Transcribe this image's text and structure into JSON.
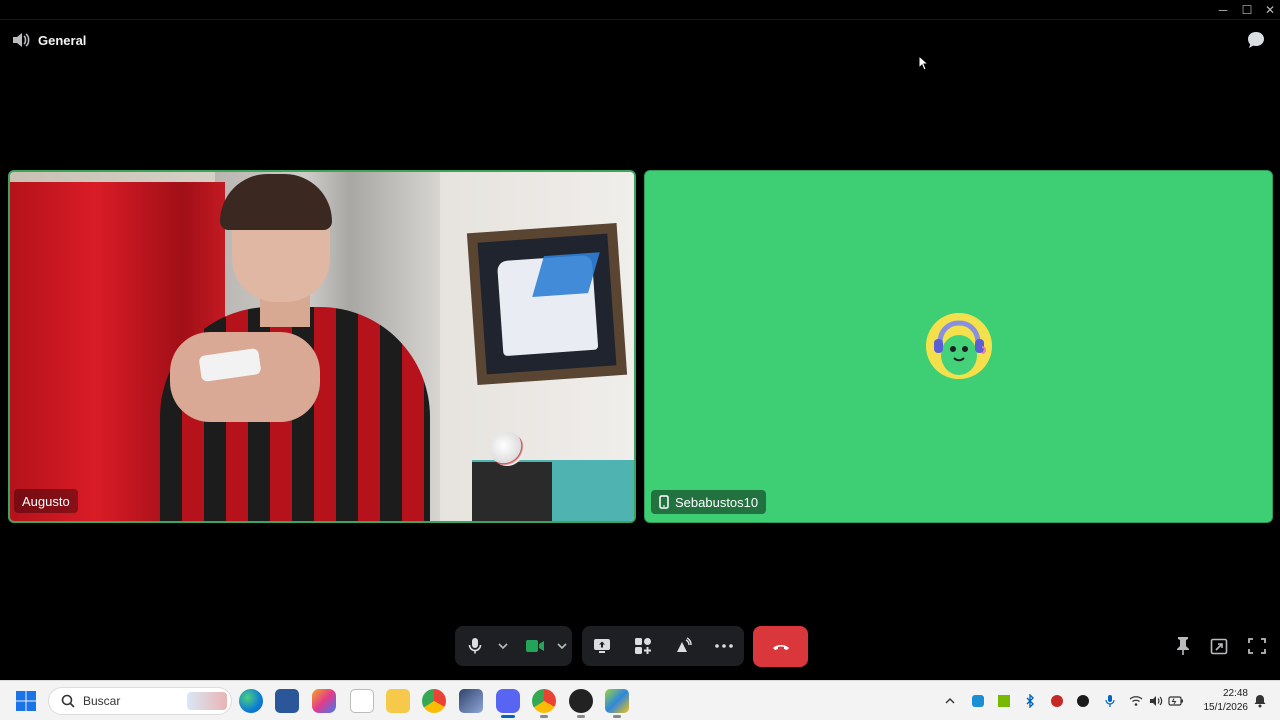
{
  "window": {
    "minimize_glyph": "─",
    "maximize_glyph": "☐",
    "close_glyph": "✕"
  },
  "channel": {
    "title": "General",
    "icon": "speaker-icon"
  },
  "participants": [
    {
      "name": "Augusto",
      "type": "camera"
    },
    {
      "name": "Sebabustos10",
      "type": "avatar",
      "device": "mobile-phone-icon",
      "tile_color": "#3ecf75"
    }
  ],
  "controls": {
    "microphone": "microphone-icon",
    "camera": "camera-icon",
    "screen_share": "screen-share-icon",
    "activities": "activities-icon",
    "soundboard": "soundboard-icon",
    "more": "more-icon",
    "disconnect": "hang-up-icon",
    "pin": "pin-icon",
    "popout": "popout-icon",
    "fullscreen": "fullscreen-icon"
  },
  "colors": {
    "speaking_border": "#3ba55c",
    "disconnect": "#da373c",
    "camera_active": "#23a559",
    "taskbar_accent": "#0067c0"
  },
  "taskbar": {
    "search_placeholder": "Buscar",
    "apps": [
      "start-icon",
      "edge-icon",
      "calculator-icon",
      "copilot-icon",
      "notepad-icon",
      "file-explorer-icon",
      "chrome-icon",
      "app-icon",
      "discord-icon",
      "chrome-icon",
      "obs-icon",
      "bluestacks-icon"
    ],
    "clock_time": "22:48",
    "clock_date": "15/1/2026"
  }
}
